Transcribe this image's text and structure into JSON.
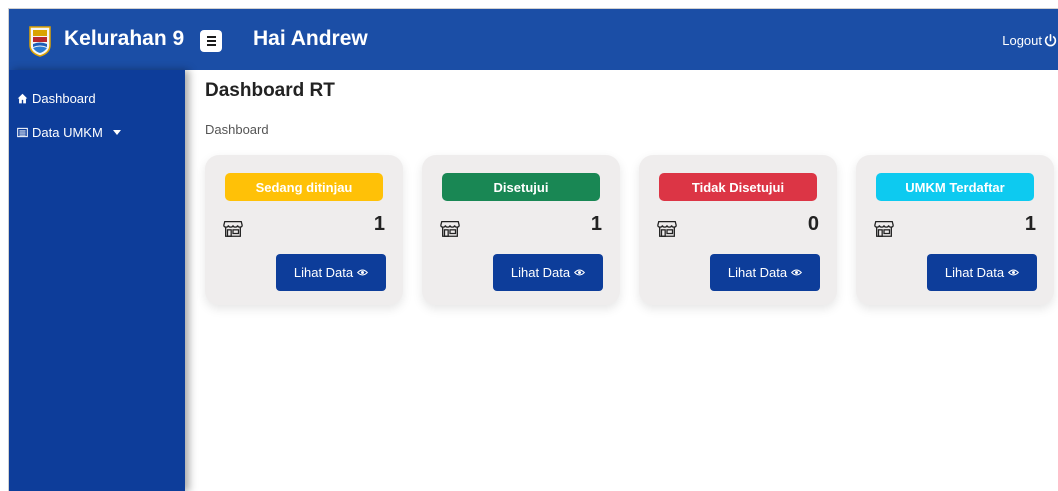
{
  "header": {
    "brand": "Kelurahan 9",
    "greeting": "Hai Andrew",
    "logout_label": "Logout"
  },
  "sidebar": {
    "items": [
      {
        "label": "Dashboard",
        "icon": "home-icon"
      },
      {
        "label": "Data UMKM",
        "icon": "list-icon",
        "has_dropdown": true
      }
    ]
  },
  "main": {
    "title": "Dashboard RT",
    "breadcrumb": "Dashboard",
    "cards": [
      {
        "label": "Sedang ditinjau",
        "count": "1",
        "button": "Lihat Data",
        "color": "#ffc107"
      },
      {
        "label": "Disetujui",
        "count": "1",
        "button": "Lihat Data",
        "color": "#198754"
      },
      {
        "label": "Tidak Disetujui",
        "count": "0",
        "button": "Lihat Data",
        "color": "#dc3545"
      },
      {
        "label": "UMKM Terdaftar",
        "count": "1",
        "button": "Lihat Data",
        "color": "#0dcaf0"
      }
    ]
  },
  "colors": {
    "topbar": "#1b4ea6",
    "sidebar": "#0d3d9a",
    "card_bg": "#efeded",
    "button": "#0d3d9a"
  }
}
